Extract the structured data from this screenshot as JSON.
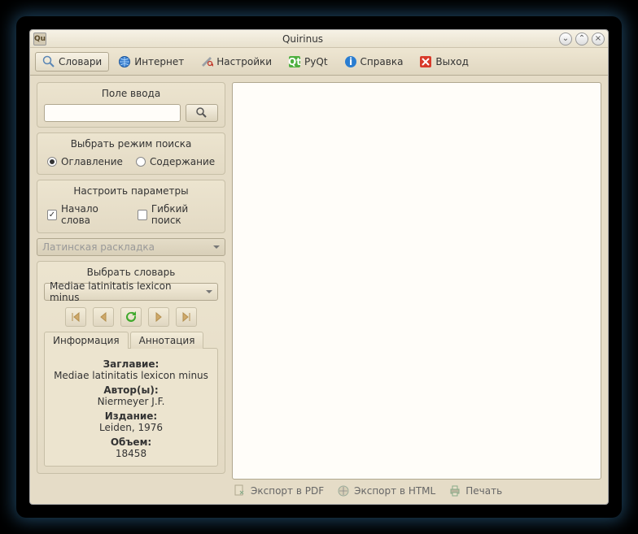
{
  "window": {
    "title": "Quirinus",
    "app_mark": "Qu"
  },
  "win_buttons": {
    "min": "⌄",
    "max": "⌃",
    "close": "×"
  },
  "toolbar": [
    {
      "name": "dictionaries",
      "label": "Словари",
      "icon": "magnifier"
    },
    {
      "name": "internet",
      "label": "Интернет",
      "icon": "globe"
    },
    {
      "name": "settings",
      "label": "Настройки",
      "icon": "wrench"
    },
    {
      "name": "pyqt",
      "label": "PyQt",
      "icon": "qt"
    },
    {
      "name": "help",
      "label": "Справка",
      "icon": "info"
    },
    {
      "name": "exit",
      "label": "Выход",
      "icon": "exit"
    }
  ],
  "input_panel": {
    "title": "Поле ввода",
    "placeholder": "",
    "value": ""
  },
  "mode_panel": {
    "title": "Выбрать режим поиска",
    "options": [
      {
        "label": "Оглавление",
        "selected": true
      },
      {
        "label": "Содержание",
        "selected": false
      }
    ]
  },
  "params_panel": {
    "title": "Настроить параметры",
    "checks": [
      {
        "label": "Начало слова",
        "checked": true
      },
      {
        "label": "Гибкий поиск",
        "checked": false
      }
    ],
    "layout_select": {
      "value": "Латинская раскладка",
      "enabled": false
    }
  },
  "dict_panel": {
    "title": "Выбрать словарь",
    "select": {
      "value": "Mediae latinitatis lexicon minus"
    },
    "buttons": [
      "nav-first",
      "nav-prev",
      "refresh",
      "nav-next",
      "nav-last"
    ]
  },
  "tabs": [
    {
      "label": "Информация",
      "active": true
    },
    {
      "label": "Аннотация",
      "active": false
    }
  ],
  "info": {
    "title_label": "Заглавие:",
    "title_value": "Mediae latinitatis lexicon minus",
    "author_label": "Автор(ы):",
    "author_value": "Niermeyer J.F.",
    "edition_label": "Издание:",
    "edition_value": "Leiden, 1976",
    "volume_label": "Объем:",
    "volume_value": "18458"
  },
  "export": {
    "pdf": "Экспорт в PDF",
    "html": "Экспорт в HTML",
    "print": "Печать"
  }
}
